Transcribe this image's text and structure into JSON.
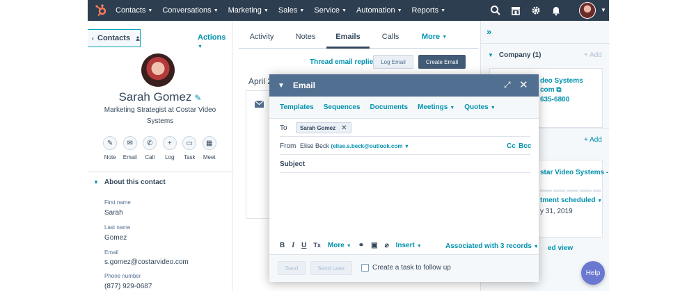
{
  "colors": {
    "nav_bg": "#2d3e50",
    "accent": "#0091ae",
    "modal_header": "#516f90",
    "primary_button": "#425b76",
    "help": "#6a78d1"
  },
  "topnav": {
    "items": [
      {
        "label": "Contacts"
      },
      {
        "label": "Conversations"
      },
      {
        "label": "Marketing"
      },
      {
        "label": "Sales"
      },
      {
        "label": "Service"
      },
      {
        "label": "Automation"
      },
      {
        "label": "Reports"
      }
    ],
    "icons": [
      "search-icon",
      "marketplace-icon",
      "gear-icon",
      "bell-icon"
    ]
  },
  "left": {
    "back_label": "Contacts",
    "actions_label": "Actions",
    "name": "Sarah Gomez",
    "title": "Marketing Strategist at Costar Video Systems",
    "quick_actions": [
      {
        "label": "Note",
        "icon": "note-icon"
      },
      {
        "label": "Email",
        "icon": "email-icon"
      },
      {
        "label": "Call",
        "icon": "phone-icon"
      },
      {
        "label": "Log",
        "icon": "plus-icon"
      },
      {
        "label": "Task",
        "icon": "task-icon"
      },
      {
        "label": "Meet",
        "icon": "calendar-icon"
      }
    ],
    "about_heading": "About this contact",
    "properties": [
      {
        "label": "First name",
        "value": "Sarah"
      },
      {
        "label": "Last name",
        "value": "Gomez"
      },
      {
        "label": "Email",
        "value": "s.gomez@costarvideo.com"
      },
      {
        "label": "Phone number",
        "value": "(877) 929-0687"
      }
    ]
  },
  "middle": {
    "tabs": [
      {
        "label": "Activity",
        "active": false
      },
      {
        "label": "Notes",
        "active": false
      },
      {
        "label": "Emails",
        "active": true
      },
      {
        "label": "Calls",
        "active": false
      },
      {
        "label": "More",
        "active": false
      }
    ],
    "thread_link": "Thread email replies",
    "log_button": "Log Email",
    "create_button": "Create Email",
    "month_label": "April 2"
  },
  "right": {
    "company_heading": "Company (1)",
    "company_add": "+ Add",
    "company_name": "deo Systems",
    "company_domain": "com",
    "company_phone": "635-6800",
    "deals_add": "+ Add",
    "deal_name": "star Video Systems -",
    "deal_stage": "tment scheduled",
    "deal_date": "y 31, 2019",
    "view_link": "ed view"
  },
  "help_label": "Help",
  "email": {
    "title": "Email",
    "toolbar": [
      {
        "label": "Templates",
        "dropdown": false
      },
      {
        "label": "Sequences",
        "dropdown": false
      },
      {
        "label": "Documents",
        "dropdown": false
      },
      {
        "label": "Meetings",
        "dropdown": true
      },
      {
        "label": "Quotes",
        "dropdown": true
      }
    ],
    "to_label": "To",
    "to_chip": "Sarah Gomez",
    "from_label": "From",
    "from_name": "Elise Beck",
    "from_address": "(elise.s.beck@outlook.com",
    "cc_label": "Cc",
    "bcc_label": "Bcc",
    "subject_label": "Subject",
    "format": {
      "bold": "B",
      "italic": "I",
      "underline": "U",
      "clear": "Tx",
      "more": "More",
      "insert": "Insert"
    },
    "associated_label": "Associated with 3 records",
    "send_label": "Send",
    "send_later_label": "Send Later",
    "task_label": "Create a task to follow up",
    "task_checked": false
  }
}
